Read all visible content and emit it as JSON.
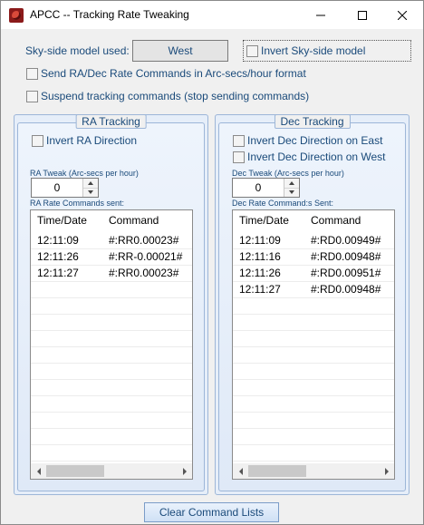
{
  "window": {
    "title": "APCC -- Tracking Rate Tweaking"
  },
  "sky_model": {
    "label": "Sky-side model used:",
    "value": "West",
    "invert_label": "Invert Sky-side model"
  },
  "options": {
    "send_arcsecs_label": "Send RA/Dec Rate Commands in Arc-secs/hour format",
    "suspend_label": "Suspend tracking commands (stop sending commands)"
  },
  "ra": {
    "title": "RA Tracking",
    "invert_label": "Invert RA Direction",
    "tweak_label": "RA Tweak (Arc-secs per hour)",
    "tweak_value": "0",
    "sent_label": "RA Rate Commands sent:",
    "columns": [
      "Time/Date",
      "Command"
    ],
    "rows": [
      [
        "12:11:09",
        "#:RR0.00023#"
      ],
      [
        "12:11:26",
        "#:RR-0.00021#"
      ],
      [
        "12:11:27",
        "#:RR0.00023#"
      ]
    ]
  },
  "dec": {
    "title": "Dec Tracking",
    "invert_east_label": "Invert Dec Direction on East",
    "invert_west_label": "Invert Dec Direction on West",
    "tweak_label": "Dec Tweak (Arc-secs per hour)",
    "tweak_value": "0",
    "sent_label": "Dec Rate Command:s Sent:",
    "columns": [
      "Time/Date",
      "Command"
    ],
    "rows": [
      [
        "12:11:09",
        "#:RD0.00949#"
      ],
      [
        "12:11:16",
        "#:RD0.00948#"
      ],
      [
        "12:11:26",
        "#:RD0.00951#"
      ],
      [
        "12:11:27",
        "#:RD0.00948#"
      ]
    ]
  },
  "clear_button": "Clear Command Lists"
}
